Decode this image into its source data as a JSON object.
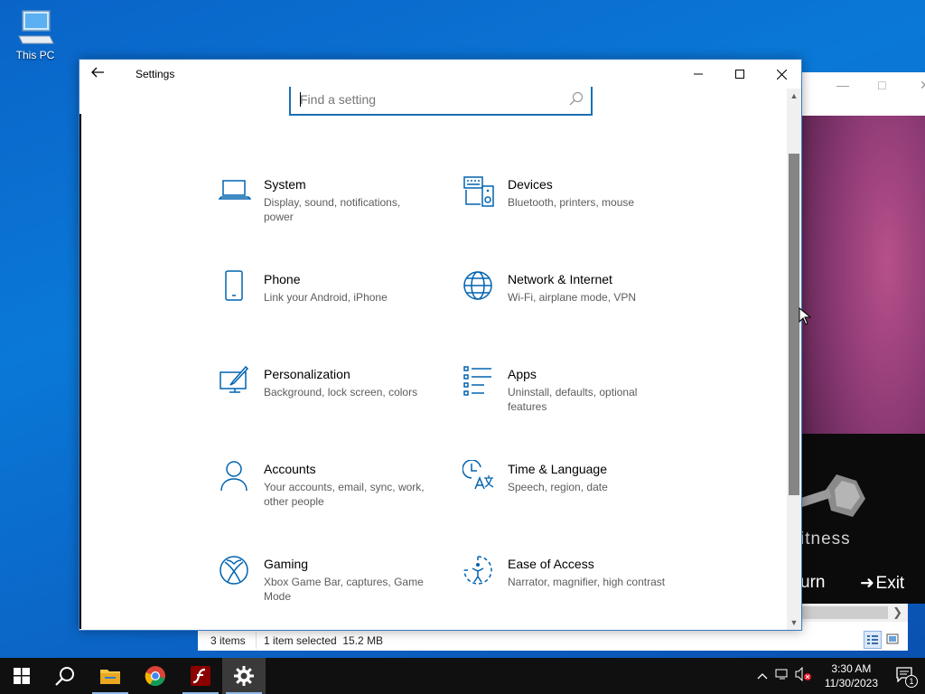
{
  "desktop": {
    "icons": [
      {
        "label": "This PC",
        "icon": "computer-icon"
      }
    ]
  },
  "background_app": {
    "fitness_text": "itness",
    "return_label": "urn",
    "exit_label": "Exit"
  },
  "explorer": {
    "status_items": "3 items",
    "status_selected": "1 item selected  15.2 MB"
  },
  "settings": {
    "title": "Settings",
    "search_placeholder": "Find a setting",
    "categories": [
      {
        "title": "System",
        "desc": "Display, sound, notifications, power",
        "icon": "laptop-icon"
      },
      {
        "title": "Devices",
        "desc": "Bluetooth, printers, mouse",
        "icon": "keyboard-speaker-icon"
      },
      {
        "title": "Phone",
        "desc": "Link your Android, iPhone",
        "icon": "phone-icon"
      },
      {
        "title": "Network & Internet",
        "desc": "Wi-Fi, airplane mode, VPN",
        "icon": "globe-icon"
      },
      {
        "title": "Personalization",
        "desc": "Background, lock screen, colors",
        "icon": "paint-brush-icon"
      },
      {
        "title": "Apps",
        "desc": "Uninstall, defaults, optional features",
        "icon": "apps-list-icon"
      },
      {
        "title": "Accounts",
        "desc": "Your accounts, email, sync, work, other people",
        "icon": "person-icon"
      },
      {
        "title": "Time & Language",
        "desc": "Speech, region, date",
        "icon": "time-language-icon"
      },
      {
        "title": "Gaming",
        "desc": "Xbox Game Bar, captures, Game Mode",
        "icon": "xbox-icon"
      },
      {
        "title": "Ease of Access",
        "desc": "Narrator, magnifier, high contrast",
        "icon": "ease-of-access-icon"
      }
    ]
  },
  "taskbar": {
    "apps": [
      {
        "name": "start",
        "icon": "windows-logo-icon"
      },
      {
        "name": "search",
        "icon": "search-icon"
      },
      {
        "name": "file-explorer",
        "icon": "folder-icon"
      },
      {
        "name": "chrome",
        "icon": "chrome-icon"
      },
      {
        "name": "flash",
        "icon": "flash-icon"
      },
      {
        "name": "settings",
        "icon": "gear-icon",
        "active": true
      }
    ],
    "time": "3:30 AM",
    "date": "11/30/2023",
    "notification_count": "1"
  },
  "colors": {
    "accent": "#0063b1",
    "desktop": "#0a78d7",
    "taskbar": "#101010"
  }
}
